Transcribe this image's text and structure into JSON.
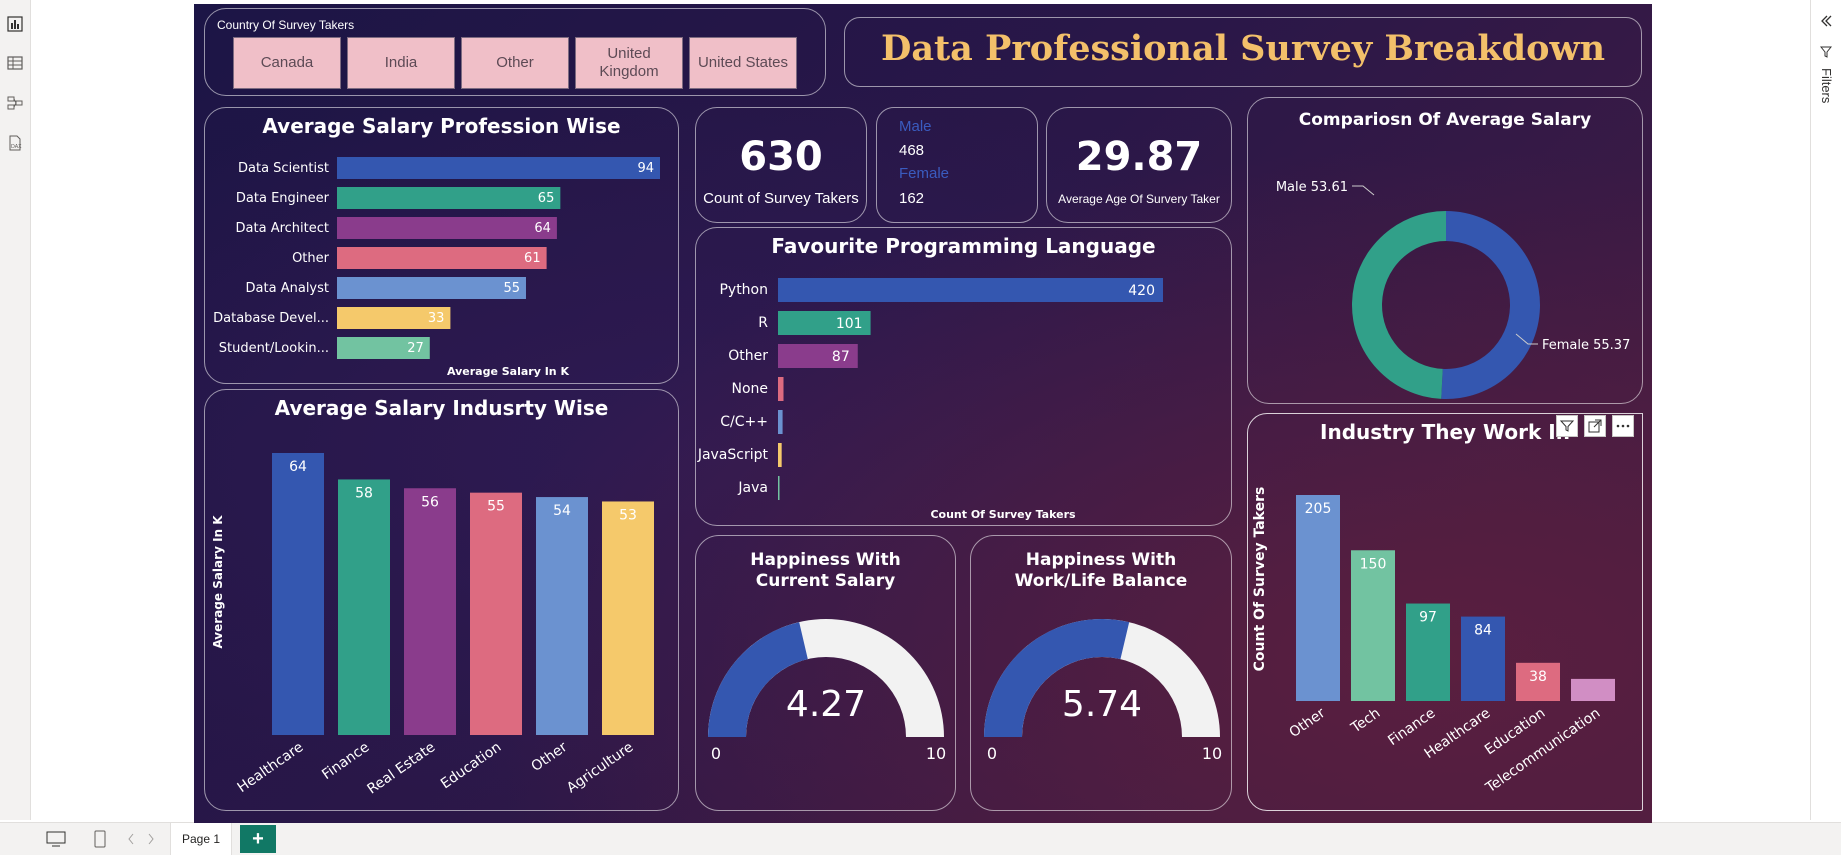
{
  "app": {
    "page_tab": "Page 1",
    "add_page_symbol": "+",
    "filters_label": "Filters"
  },
  "colors": {
    "blue": "#3457b0",
    "teal": "#31a089",
    "purple": "#8a3c8c",
    "coral": "#dd6b80",
    "lightblue": "#6b92d0",
    "yellow": "#f5c96b",
    "mint": "#72c3a1",
    "pink": "#d18ec4",
    "title_gold": "#f3c06a"
  },
  "slicer": {
    "title": "Country Of Survey Takers",
    "options": [
      "Canada",
      "India",
      "Other",
      "United Kingdom",
      "United States"
    ]
  },
  "header": {
    "title": "Data Professional Survey Breakdown"
  },
  "kpi": {
    "count": {
      "value": "630",
      "label": "Count of Survey Takers"
    },
    "gender": {
      "male_label": "Male",
      "male_value": "468",
      "female_label": "Female",
      "female_value": "162"
    },
    "age": {
      "value": "29.87",
      "label": "Average Age Of Survery Taker"
    }
  },
  "salary_profession": {
    "title": "Average Salary Profession Wise",
    "xlabel": "Average Salary In K",
    "chart_data": {
      "type": "bar",
      "orientation": "horizontal",
      "categories": [
        "Data Scientist",
        "Data Engineer",
        "Data Architect",
        "Other",
        "Data Analyst",
        "Database Devel...",
        "Student/Lookin..."
      ],
      "values": [
        94,
        65,
        64,
        61,
        55,
        33,
        27
      ],
      "xlim": [
        0,
        94
      ]
    }
  },
  "language": {
    "title": "Favourite Programming Language",
    "xlabel": "Count Of Survey Takers",
    "chart_data": {
      "type": "bar",
      "orientation": "horizontal",
      "categories": [
        "Python",
        "R",
        "Other",
        "None",
        "C/C++",
        "JavaScript",
        "Java"
      ],
      "values": [
        420,
        101,
        87,
        6,
        5,
        4,
        1
      ],
      "labels": [
        "420",
        "101",
        "87",
        "",
        "",
        "",
        ""
      ],
      "xlim": [
        0,
        420
      ]
    }
  },
  "avg_salary_gender": {
    "title": "Compariosn Of Average Salary",
    "chart_data": {
      "type": "pie",
      "donut": true,
      "categories": [
        "Male",
        "Female"
      ],
      "values": [
        53.61,
        55.37
      ],
      "labels": [
        "Male 53.61",
        "Female 55.37"
      ]
    }
  },
  "salary_industry": {
    "title": "Average Salary Indusrty Wise",
    "ylabel": "Average Salary In K",
    "chart_data": {
      "type": "bar",
      "categories": [
        "Healthcare",
        "Finance",
        "Real Estate",
        "Education",
        "Other",
        "Agriculture"
      ],
      "values": [
        64,
        58,
        56,
        55,
        54,
        53
      ],
      "ylim": [
        0,
        64
      ]
    }
  },
  "happiness_salary": {
    "title": "Happiness With Current Salary",
    "value": 4.27,
    "value_text": "4.27",
    "min_text": "0",
    "max_text": "10",
    "max": 10
  },
  "happiness_balance": {
    "title": "Happiness With Work/Life Balance",
    "value": 5.74,
    "value_text": "5.74",
    "min_text": "0",
    "max_text": "10",
    "max": 10
  },
  "industry": {
    "title": "Industry They Work In",
    "ylabel": "Count Of Survey Takers",
    "chart_data": {
      "type": "bar",
      "categories": [
        "Other",
        "Tech",
        "Finance",
        "Healthcare",
        "Education",
        "Telecommunication"
      ],
      "values": [
        205,
        150,
        97,
        84,
        38,
        22
      ],
      "labels": [
        "205",
        "150",
        "97",
        "84",
        "38",
        ""
      ],
      "ylim": [
        0,
        205
      ]
    }
  }
}
